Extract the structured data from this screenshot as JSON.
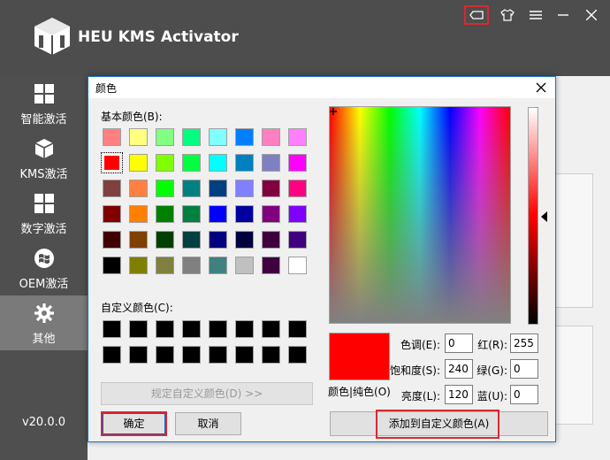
{
  "app": {
    "title": "HEU KMS Activator",
    "version": "v20.0.0",
    "logo_text": "HEU"
  },
  "window_controls": [
    "skin-icon",
    "shirt-icon",
    "menu-icon",
    "minimize-icon",
    "close-icon"
  ],
  "sidebar": {
    "items": [
      {
        "label": "智能激活",
        "icon": "windows-icon"
      },
      {
        "label": "KMS激活",
        "icon": "cube-icon"
      },
      {
        "label": "数字激活",
        "icon": "grid-icon"
      },
      {
        "label": "OEM激活",
        "icon": "windows-flag-icon"
      },
      {
        "label": "其他",
        "icon": "gear-icon"
      }
    ]
  },
  "dialog": {
    "title": "颜色",
    "basic_colors_label": "基本颜色(B):",
    "custom_colors_label": "自定义颜色(C):",
    "define_button": "规定自定义颜色(D) >>",
    "ok_button": "确定",
    "cancel_button": "取消",
    "preview_label": "颜色|纯色(O)",
    "add_button": "添加到自定义颜色(A)",
    "fields": {
      "hue": {
        "label": "色调(E):",
        "value": "0"
      },
      "sat": {
        "label": "饱和度(S):",
        "value": "240"
      },
      "lum": {
        "label": "亮度(L):",
        "value": "120"
      },
      "red": {
        "label": "红(R):",
        "value": "255"
      },
      "green": {
        "label": "绿(G):",
        "value": "0"
      },
      "blue": {
        "label": "蓝(U):",
        "value": "0"
      }
    },
    "basic_colors": [
      "#ff8080",
      "#ffff80",
      "#80ff80",
      "#00ff80",
      "#80ffff",
      "#0080ff",
      "#ff80c0",
      "#ff80ff",
      "#ff0000",
      "#ffff00",
      "#80ff00",
      "#00ff40",
      "#00ffff",
      "#0080c0",
      "#8080c0",
      "#ff00ff",
      "#804040",
      "#ff8040",
      "#00ff00",
      "#008080",
      "#004080",
      "#8080ff",
      "#800040",
      "#ff0080",
      "#800000",
      "#ff8000",
      "#008000",
      "#008040",
      "#0000ff",
      "#0000a0",
      "#800080",
      "#8000ff",
      "#400000",
      "#804000",
      "#004000",
      "#004040",
      "#000080",
      "#000040",
      "#400040",
      "#400080",
      "#000000",
      "#808000",
      "#808040",
      "#808080",
      "#408080",
      "#c0c0c0",
      "#400040",
      "#ffffff"
    ],
    "selected_index": 8,
    "custom_colors": [
      "#000000",
      "#000000",
      "#000000",
      "#000000",
      "#000000",
      "#000000",
      "#000000",
      "#000000",
      "#000000",
      "#000000",
      "#000000",
      "#000000",
      "#000000",
      "#000000",
      "#000000",
      "#000000"
    ],
    "current_color": "#ff0000"
  },
  "colors": {
    "titlebar": "#4d4d4d",
    "highlight": "#d8282f",
    "dialog_border": "#1a75c9"
  }
}
